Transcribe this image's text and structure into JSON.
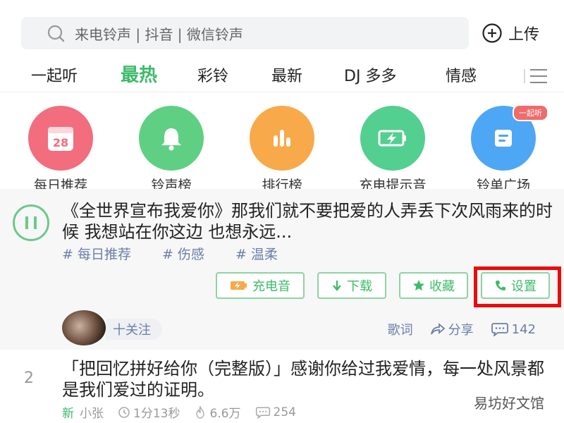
{
  "search": {
    "placeholder": "来电铃声 | 抖音 | 微信铃声",
    "upload_label": "上传"
  },
  "tabs": [
    {
      "label": "一起听",
      "active": false
    },
    {
      "label": "最热",
      "active": true
    },
    {
      "label": "彩铃",
      "active": false
    },
    {
      "label": "最新",
      "active": false
    },
    {
      "label": "DJ 多多",
      "active": false
    },
    {
      "label": "情感",
      "active": false
    }
  ],
  "categories": [
    {
      "label": "每日推荐",
      "icon": "calendar-icon",
      "icon_text": "28",
      "color": "#f26d7d"
    },
    {
      "label": "铃声榜",
      "icon": "bell-icon",
      "color": "#5fd083"
    },
    {
      "label": "排行榜",
      "icon": "bar-chart-icon",
      "color": "#f8a94a"
    },
    {
      "label": "充电提示音",
      "icon": "battery-icon",
      "color": "#53cf8f"
    },
    {
      "label": "铃单广场",
      "icon": "list-icon",
      "color": "#4ea7f4",
      "badge": "一起听"
    }
  ],
  "song1": {
    "text": "《全世界宣布我爱你》那我们就不要把爱的人弄丢下次风雨来的时候 我想站在你这边 也想永远...",
    "tags": [
      "# 每日推荐",
      "# 伤感",
      "# 温柔"
    ],
    "actions": {
      "charge": "充电音",
      "download": "下载",
      "favorite": "收藏",
      "set": "设置"
    },
    "follow_label": "十关注",
    "lyrics_label": "歌词",
    "share_label": "分享",
    "comments": "142"
  },
  "song2": {
    "rank": "2",
    "text": "「把回忆拼好给你（完整版）」感谢你给过我爱情，每一处风景都是我们爱过的证明。",
    "new_label": "新",
    "author": "小张",
    "duration": "1分13秒",
    "plays": "6.6万",
    "comments": "254"
  },
  "watermark": "易坊好文馆",
  "colors": {
    "accent": "#3dbb6a",
    "highlight": "#e80d0d",
    "tag": "#6a7fa8"
  }
}
